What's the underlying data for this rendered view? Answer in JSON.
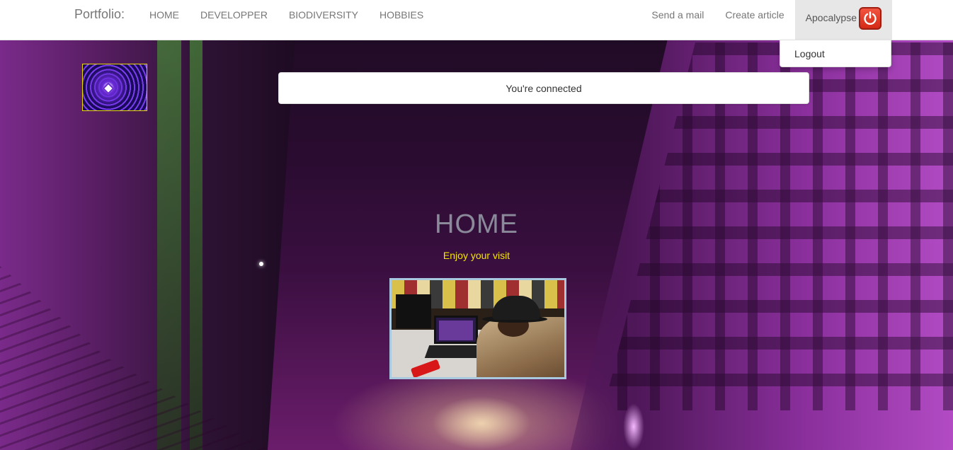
{
  "navbar": {
    "brand": "Portfolio:",
    "items": [
      {
        "label": "HOME"
      },
      {
        "label": "DEVELOPPER"
      },
      {
        "label": "BIODIVERSITY"
      },
      {
        "label": "HOBBIES"
      }
    ],
    "right_items": [
      {
        "label": "Send a mail"
      },
      {
        "label": "Create article"
      }
    ],
    "user": {
      "name": "Apocalypse",
      "icon": "power-icon"
    }
  },
  "dropdown": {
    "items": [
      {
        "label": "Logout"
      }
    ]
  },
  "alert": {
    "message": "You're connected"
  },
  "main": {
    "title": "HOME",
    "subtitle": "Enjoy your visit"
  },
  "colors": {
    "subtitle": "#f5e400",
    "power_button": "#e03a25",
    "logo_border": "#e8d900"
  }
}
